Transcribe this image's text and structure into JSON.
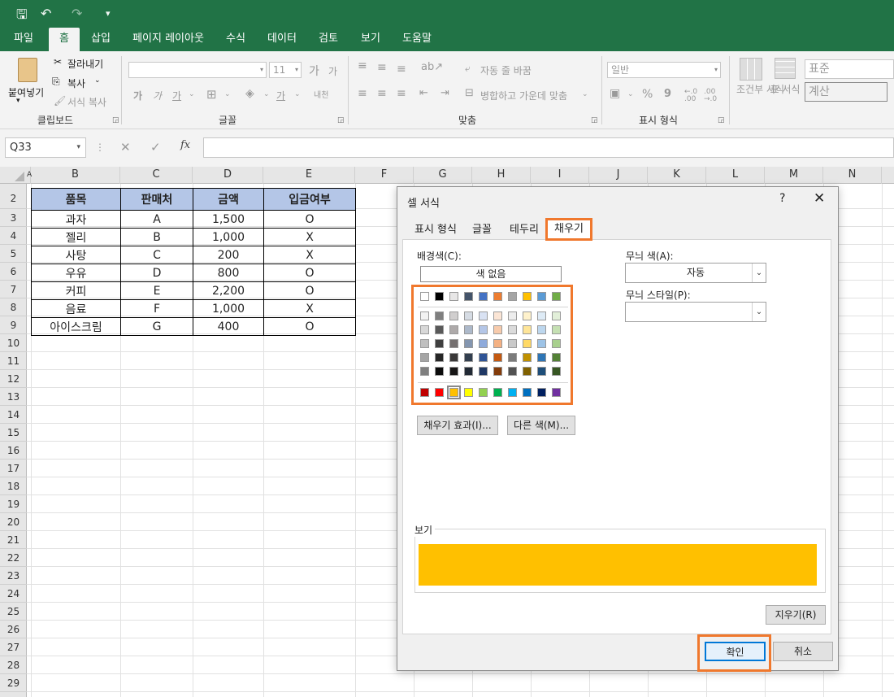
{
  "qat": {
    "save": "🖫",
    "undo": "↶",
    "redo": "↷",
    "more": "▾"
  },
  "tabs": [
    "파일",
    "홈",
    "삽입",
    "페이지 레이아웃",
    "수식",
    "데이터",
    "검토",
    "보기",
    "도움말"
  ],
  "active_tab": "홈",
  "ribbon": {
    "clipboard": {
      "paste": "붙여넣기",
      "cut": "잘라내기",
      "copy": "복사",
      "format_painter": "서식 복사",
      "label": "클립보드"
    },
    "font": {
      "font_name": "",
      "font_size": "11",
      "grow": "가",
      "shrink": "가",
      "bold": "가",
      "italic": "가",
      "underline": "가",
      "phonetic": "내천",
      "label": "글꼴"
    },
    "align": {
      "wrap": "자동 줄 바꿈",
      "merge": "병합하고 가운데 맞춤",
      "label": "맞춤"
    },
    "number": {
      "format": "일반",
      "percent": "%",
      "comma": "9",
      "inc_dec": "←.0 .00",
      "dec_dec": ".00 →.0",
      "label": "표시 형식"
    },
    "styles": {
      "cond": "조건부 서식",
      "table": "표 서식",
      "style1": "표준",
      "style2": "계산"
    }
  },
  "formula_bar": {
    "name_box": "Q33",
    "cancel": "✕",
    "enter": "✓",
    "fx": "fx",
    "value": ""
  },
  "columns": [
    "A",
    "B",
    "C",
    "D",
    "E",
    "F",
    "G",
    "H",
    "I",
    "J",
    "K",
    "L",
    "M",
    "N"
  ],
  "rows": [
    "2",
    "3",
    "4",
    "5",
    "6",
    "7",
    "8",
    "9",
    "10",
    "11",
    "12",
    "13",
    "14",
    "15",
    "16",
    "17",
    "18",
    "19",
    "20",
    "21",
    "22",
    "23",
    "24",
    "25",
    "26",
    "27",
    "28",
    "29"
  ],
  "table": {
    "headers": [
      "품목",
      "판매처",
      "금액",
      "입금여부"
    ],
    "rows": [
      [
        "과자",
        "A",
        "1,500",
        "O"
      ],
      [
        "젤리",
        "B",
        "1,000",
        "X"
      ],
      [
        "사탕",
        "C",
        "200",
        "X"
      ],
      [
        "우유",
        "D",
        "800",
        "O"
      ],
      [
        "커피",
        "E",
        "2,200",
        "O"
      ],
      [
        "음료",
        "F",
        "1,000",
        "X"
      ],
      [
        "아이스크림",
        "G",
        "400",
        "O"
      ]
    ],
    "header_color": "#b4c6e7"
  },
  "dialog": {
    "title": "셀 서식",
    "help": "?",
    "close": "✕",
    "tabs": [
      "표시 형식",
      "글꼴",
      "테두리",
      "채우기"
    ],
    "active_tab": "채우기",
    "bg_color_label": "배경색(C):",
    "no_color": "색 없음",
    "pattern_color_label": "무늬 색(A):",
    "pattern_color_value": "자동",
    "pattern_style_label": "무늬 스타일(P):",
    "pattern_style_value": "",
    "fill_effects": "채우기 효과(I)...",
    "more_colors": "다른 색(M)...",
    "preview_label": "보기",
    "clear": "지우기(R)",
    "ok": "확인",
    "cancel": "취소",
    "preview_color": "#ffc000",
    "palette": {
      "theme_top": [
        "#ffffff",
        "#000000",
        "#e7e6e6",
        "#44546a",
        "#4472c4",
        "#ed7d31",
        "#a5a5a5",
        "#ffc000",
        "#5b9bd5",
        "#70ad47"
      ],
      "theme_tints": [
        [
          "#f2f2f2",
          "#7f7f7f",
          "#d0cece",
          "#d6dce4",
          "#d9e2f3",
          "#fbe5d5",
          "#ededed",
          "#fff2cc",
          "#deebf6",
          "#e2efd9"
        ],
        [
          "#d8d8d8",
          "#595959",
          "#aeaaaa",
          "#adb9ca",
          "#b4c6e7",
          "#f7cbac",
          "#dbdbdb",
          "#fee599",
          "#bdd7ee",
          "#c5e0b3"
        ],
        [
          "#bfbfbf",
          "#3f3f3f",
          "#757070",
          "#8496b0",
          "#8eaadb",
          "#f4b183",
          "#c9c9c9",
          "#ffd965",
          "#9dc3e6",
          "#a8d08d"
        ],
        [
          "#a5a5a5",
          "#262626",
          "#3a3838",
          "#323f4f",
          "#2f5496",
          "#c45911",
          "#7b7b7b",
          "#bf9000",
          "#2e75b5",
          "#538135"
        ],
        [
          "#7f7f7f",
          "#0c0c0c",
          "#171616",
          "#222a35",
          "#1f3864",
          "#833c0b",
          "#525252",
          "#7f6000",
          "#1e4e79",
          "#375623"
        ]
      ],
      "standard": [
        "#c00000",
        "#ff0000",
        "#ffc000",
        "#ffff00",
        "#92d050",
        "#00b050",
        "#00b0f0",
        "#0070c0",
        "#002060",
        "#7030a0"
      ],
      "selected_standard_index": 2
    }
  }
}
